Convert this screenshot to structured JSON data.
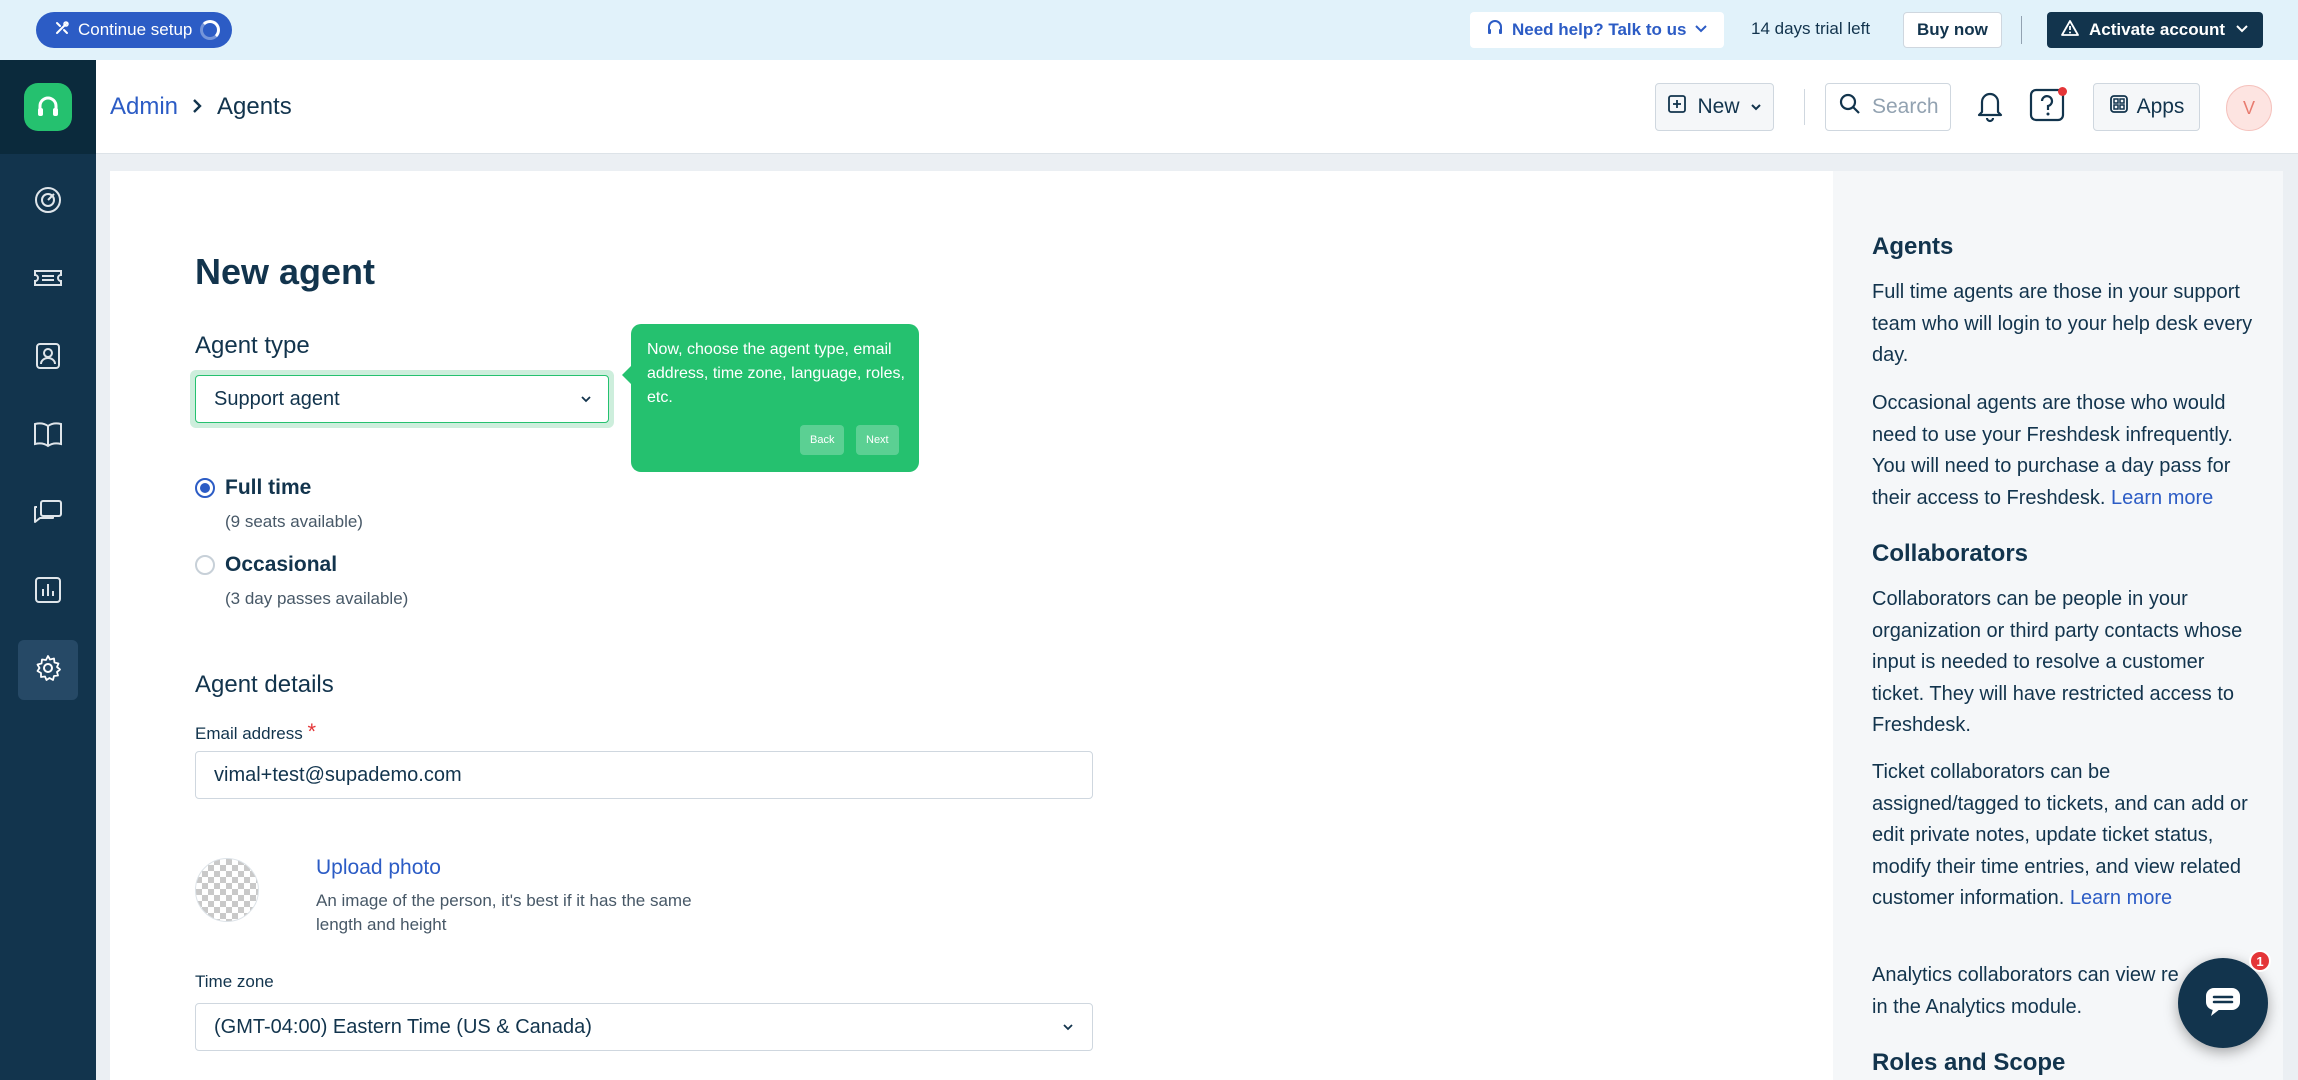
{
  "banner": {
    "continue_label": "Continue setup",
    "help_label": "Need help? Talk to us",
    "trial_text": "14 days trial left",
    "buy_label": "Buy now",
    "activate_label": "Activate account"
  },
  "header": {
    "breadcrumb_root": "Admin",
    "breadcrumb_current": "Agents",
    "new_label": "New",
    "search_placeholder": "Search",
    "apps_label": "Apps",
    "avatar_initial": "V"
  },
  "sidebar": {
    "items": [
      {
        "icon": "dashboard-icon"
      },
      {
        "icon": "tickets-icon"
      },
      {
        "icon": "contacts-icon"
      },
      {
        "icon": "solutions-icon"
      },
      {
        "icon": "forums-icon"
      },
      {
        "icon": "reports-icon"
      },
      {
        "icon": "admin-icon",
        "active": true
      }
    ]
  },
  "form": {
    "title": "New agent",
    "agent_type_heading": "Agent type",
    "agent_type_value": "Support agent",
    "full_time_label": "Full time",
    "full_time_sub": "(9 seats available)",
    "occasional_label": "Occasional",
    "occasional_sub": "(3 day passes available)",
    "agent_details_heading": "Agent details",
    "email_label": "Email address",
    "email_required": "*",
    "email_value": "vimal+test@supademo.com",
    "upload_label": "Upload photo",
    "upload_desc": "An image of the person, it's best if it has the same length and height",
    "timezone_label": "Time zone",
    "timezone_value": "(GMT-04:00) Eastern Time (US & Canada)"
  },
  "tooltip": {
    "text": "Now, choose the agent type, email address, time zone, language, roles, etc.",
    "back_label": "Back",
    "next_label": "Next"
  },
  "side_panel": {
    "agents_heading": "Agents",
    "agents_p1": "Full time agents are those in your support team who will login to your help desk every day.",
    "agents_p2": "Occasional agents are those who would need to use your Freshdesk infrequently. You will need to purchase a day pass for their access to Freshdesk.",
    "learn_more_1": "Learn more",
    "collab_heading": "Collaborators",
    "collab_p1": "Collaborators can be people in your organization or third party contacts whose input is needed to resolve a customer ticket. They will have restricted access to Freshdesk.",
    "collab_p2": "Ticket collaborators can be assigned/tagged to tickets, and can add or edit private notes, update ticket status, modify their time entries, and view related customer information.",
    "learn_more_2": "Learn more",
    "collab_p3": "Analytics collaborators can view re",
    "collab_p3_tail": "in the Analytics module.",
    "roles_heading": "Roles and Scope"
  },
  "chat": {
    "badge_count": "1"
  },
  "colors": {
    "brand_green": "#25c16f",
    "primary_blue": "#2c5cc5",
    "navy": "#12344d"
  }
}
